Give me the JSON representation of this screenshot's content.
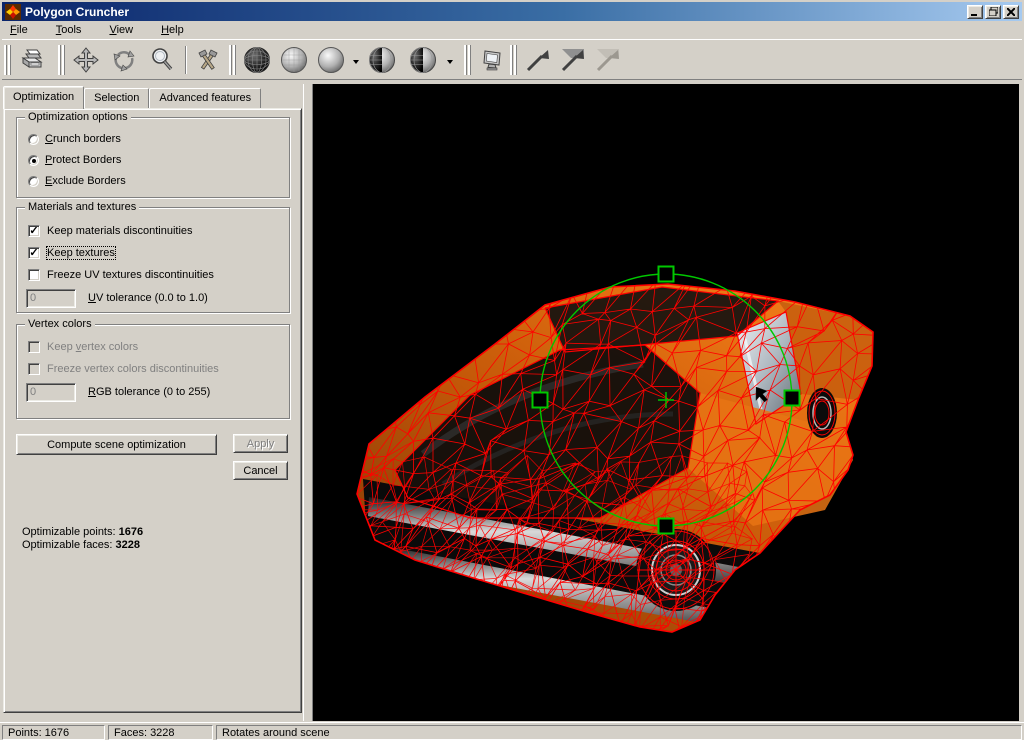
{
  "window": {
    "title": "Polygon Cruncher"
  },
  "menu": {
    "items": [
      {
        "label": "File",
        "accel": 0
      },
      {
        "label": "Tools",
        "accel": 0
      },
      {
        "label": "View",
        "accel": 0
      },
      {
        "label": "Help",
        "accel": 0
      }
    ]
  },
  "toolbar": {
    "buttons": [
      "print",
      "pan",
      "rotate",
      "zoom",
      "optimize-wizard",
      "wireframe-render",
      "faceted-render",
      "smooth-render",
      "mixed-render-a",
      "mixed-render-b",
      "viewport-setup",
      "undo-level-1",
      "undo-level-2",
      "undo-level-3"
    ]
  },
  "panel": {
    "tabs": [
      {
        "label": "Optimization",
        "active": true
      },
      {
        "label": "Selection",
        "active": false
      },
      {
        "label": "Advanced features",
        "active": false
      }
    ],
    "group_optimization": {
      "title": "Optimization options",
      "radios": [
        {
          "label": "Crunch borders",
          "accel": 0,
          "checked": false
        },
        {
          "label": "Protect Borders",
          "accel": 0,
          "checked": true
        },
        {
          "label": "Exclude Borders",
          "accel": 0,
          "checked": false
        }
      ]
    },
    "group_materials": {
      "title": "Materials and textures",
      "checks": [
        {
          "label": "Keep materials discontinuities",
          "checked": true
        },
        {
          "label": "Keep textures",
          "checked": true,
          "focused": true
        },
        {
          "label": "Freeze UV textures discontinuities",
          "checked": false
        }
      ],
      "field": {
        "value": "0",
        "label": "UV tolerance (0.0 to 1.0)",
        "accel": 0,
        "disabled": true
      }
    },
    "group_vertex": {
      "title": "Vertex colors",
      "checks": [
        {
          "label": "Keep vertex colors",
          "accel": 5,
          "checked": false,
          "disabled": true
        },
        {
          "label": "Freeze vertex colors discontinuities",
          "checked": false,
          "disabled": true
        }
      ],
      "field": {
        "value": "0",
        "label": "RGB tolerance (0 to 255)",
        "accel": 0,
        "disabled": true
      }
    },
    "buttons": {
      "compute": "Compute scene optimization",
      "apply": "Apply",
      "cancel": "Cancel"
    },
    "stats": [
      {
        "label": "Optimizable points: ",
        "value": "1676"
      },
      {
        "label": "Optimizable faces: ",
        "value": "3228"
      }
    ]
  },
  "statusbar": {
    "panels": [
      "Points: 1676",
      "Faces: 3228",
      "Rotates around scene"
    ]
  },
  "colors": {
    "face": "#d4d0c8",
    "title1": "#0a246a",
    "title2": "#3a6ea5",
    "title3": "#a6caf0",
    "vpbg": "#000000",
    "wire": "#ff0000",
    "manip": "#00c800",
    "body1": "#7a3505",
    "body2": "#d2600e",
    "body3": "#f2821e"
  }
}
